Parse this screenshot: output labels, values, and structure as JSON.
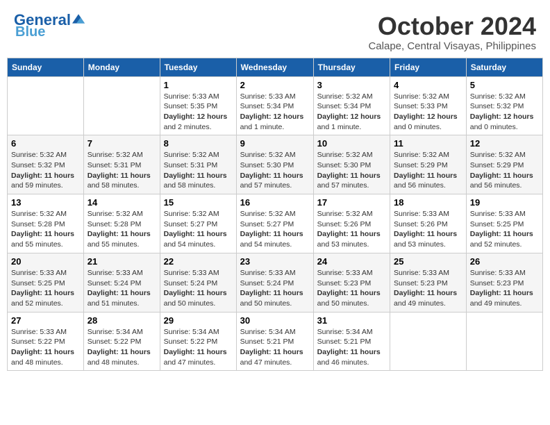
{
  "header": {
    "logo_line1": "General",
    "logo_line2": "Blue",
    "month": "October 2024",
    "location": "Calape, Central Visayas, Philippines"
  },
  "columns": [
    "Sunday",
    "Monday",
    "Tuesday",
    "Wednesday",
    "Thursday",
    "Friday",
    "Saturday"
  ],
  "weeks": [
    [
      {
        "day": "",
        "info": ""
      },
      {
        "day": "",
        "info": ""
      },
      {
        "day": "1",
        "info": "Sunrise: 5:33 AM\nSunset: 5:35 PM\nDaylight: 12 hours\nand 2 minutes."
      },
      {
        "day": "2",
        "info": "Sunrise: 5:33 AM\nSunset: 5:34 PM\nDaylight: 12 hours\nand 1 minute."
      },
      {
        "day": "3",
        "info": "Sunrise: 5:32 AM\nSunset: 5:34 PM\nDaylight: 12 hours\nand 1 minute."
      },
      {
        "day": "4",
        "info": "Sunrise: 5:32 AM\nSunset: 5:33 PM\nDaylight: 12 hours\nand 0 minutes."
      },
      {
        "day": "5",
        "info": "Sunrise: 5:32 AM\nSunset: 5:32 PM\nDaylight: 12 hours\nand 0 minutes."
      }
    ],
    [
      {
        "day": "6",
        "info": "Sunrise: 5:32 AM\nSunset: 5:32 PM\nDaylight: 11 hours\nand 59 minutes."
      },
      {
        "day": "7",
        "info": "Sunrise: 5:32 AM\nSunset: 5:31 PM\nDaylight: 11 hours\nand 58 minutes."
      },
      {
        "day": "8",
        "info": "Sunrise: 5:32 AM\nSunset: 5:31 PM\nDaylight: 11 hours\nand 58 minutes."
      },
      {
        "day": "9",
        "info": "Sunrise: 5:32 AM\nSunset: 5:30 PM\nDaylight: 11 hours\nand 57 minutes."
      },
      {
        "day": "10",
        "info": "Sunrise: 5:32 AM\nSunset: 5:30 PM\nDaylight: 11 hours\nand 57 minutes."
      },
      {
        "day": "11",
        "info": "Sunrise: 5:32 AM\nSunset: 5:29 PM\nDaylight: 11 hours\nand 56 minutes."
      },
      {
        "day": "12",
        "info": "Sunrise: 5:32 AM\nSunset: 5:29 PM\nDaylight: 11 hours\nand 56 minutes."
      }
    ],
    [
      {
        "day": "13",
        "info": "Sunrise: 5:32 AM\nSunset: 5:28 PM\nDaylight: 11 hours\nand 55 minutes."
      },
      {
        "day": "14",
        "info": "Sunrise: 5:32 AM\nSunset: 5:28 PM\nDaylight: 11 hours\nand 55 minutes."
      },
      {
        "day": "15",
        "info": "Sunrise: 5:32 AM\nSunset: 5:27 PM\nDaylight: 11 hours\nand 54 minutes."
      },
      {
        "day": "16",
        "info": "Sunrise: 5:32 AM\nSunset: 5:27 PM\nDaylight: 11 hours\nand 54 minutes."
      },
      {
        "day": "17",
        "info": "Sunrise: 5:32 AM\nSunset: 5:26 PM\nDaylight: 11 hours\nand 53 minutes."
      },
      {
        "day": "18",
        "info": "Sunrise: 5:33 AM\nSunset: 5:26 PM\nDaylight: 11 hours\nand 53 minutes."
      },
      {
        "day": "19",
        "info": "Sunrise: 5:33 AM\nSunset: 5:25 PM\nDaylight: 11 hours\nand 52 minutes."
      }
    ],
    [
      {
        "day": "20",
        "info": "Sunrise: 5:33 AM\nSunset: 5:25 PM\nDaylight: 11 hours\nand 52 minutes."
      },
      {
        "day": "21",
        "info": "Sunrise: 5:33 AM\nSunset: 5:24 PM\nDaylight: 11 hours\nand 51 minutes."
      },
      {
        "day": "22",
        "info": "Sunrise: 5:33 AM\nSunset: 5:24 PM\nDaylight: 11 hours\nand 50 minutes."
      },
      {
        "day": "23",
        "info": "Sunrise: 5:33 AM\nSunset: 5:24 PM\nDaylight: 11 hours\nand 50 minutes."
      },
      {
        "day": "24",
        "info": "Sunrise: 5:33 AM\nSunset: 5:23 PM\nDaylight: 11 hours\nand 50 minutes."
      },
      {
        "day": "25",
        "info": "Sunrise: 5:33 AM\nSunset: 5:23 PM\nDaylight: 11 hours\nand 49 minutes."
      },
      {
        "day": "26",
        "info": "Sunrise: 5:33 AM\nSunset: 5:23 PM\nDaylight: 11 hours\nand 49 minutes."
      }
    ],
    [
      {
        "day": "27",
        "info": "Sunrise: 5:33 AM\nSunset: 5:22 PM\nDaylight: 11 hours\nand 48 minutes."
      },
      {
        "day": "28",
        "info": "Sunrise: 5:34 AM\nSunset: 5:22 PM\nDaylight: 11 hours\nand 48 minutes."
      },
      {
        "day": "29",
        "info": "Sunrise: 5:34 AM\nSunset: 5:22 PM\nDaylight: 11 hours\nand 47 minutes."
      },
      {
        "day": "30",
        "info": "Sunrise: 5:34 AM\nSunset: 5:21 PM\nDaylight: 11 hours\nand 47 minutes."
      },
      {
        "day": "31",
        "info": "Sunrise: 5:34 AM\nSunset: 5:21 PM\nDaylight: 11 hours\nand 46 minutes."
      },
      {
        "day": "",
        "info": ""
      },
      {
        "day": "",
        "info": ""
      }
    ]
  ]
}
